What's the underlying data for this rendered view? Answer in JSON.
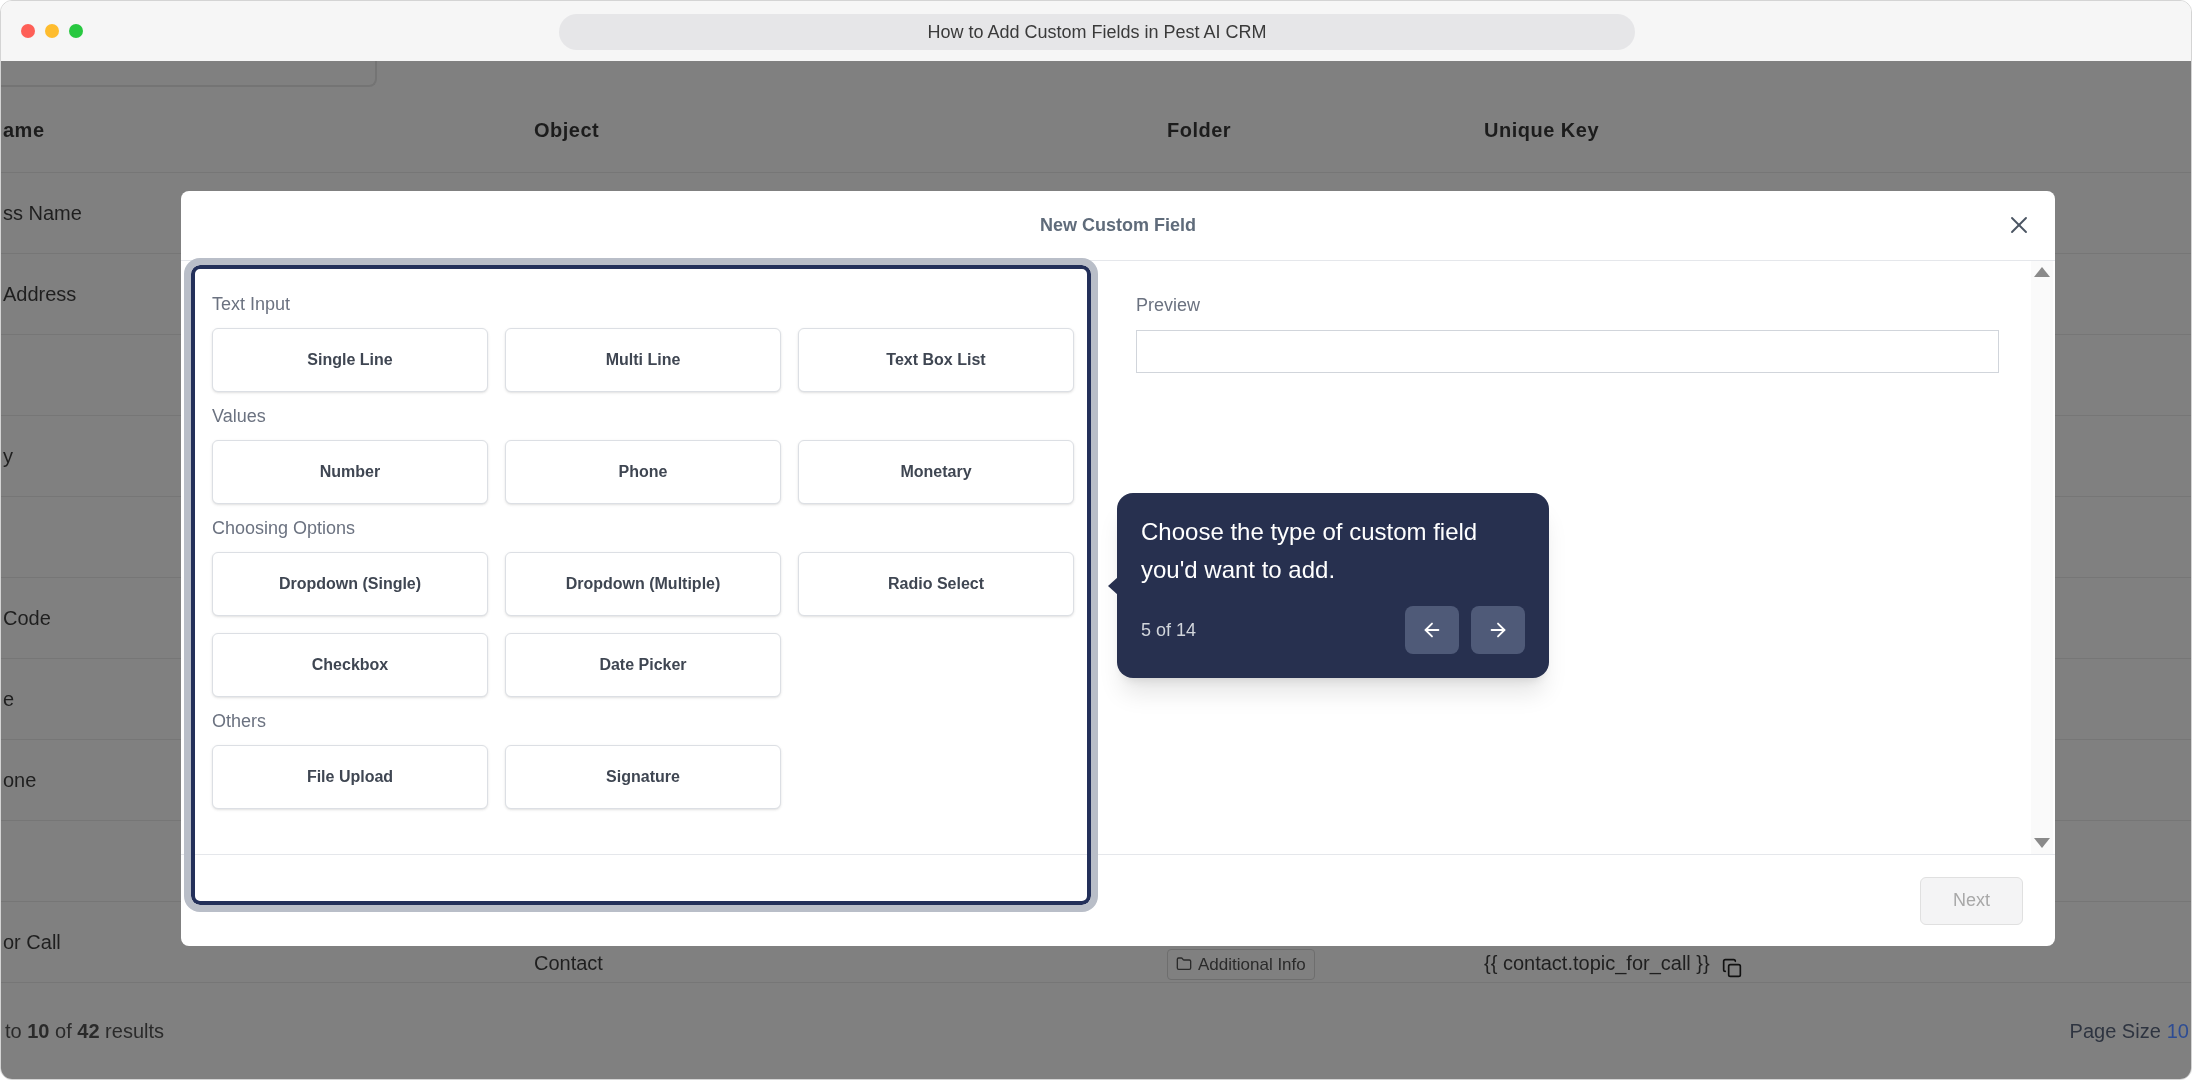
{
  "window": {
    "title": "How to Add Custom Fields in Pest AI CRM"
  },
  "table": {
    "columns": [
      "ame",
      "Object",
      "Folder",
      "Unique Key"
    ],
    "rows": [
      {
        "column_1": "ss Name"
      },
      {
        "column_1": "Address"
      },
      {},
      {
        "column_1": "y"
      },
      {},
      {
        "column_1": "Code"
      },
      {
        "column_1": "e"
      },
      {
        "column_1": "one"
      },
      {},
      {
        "column_1": "or Call",
        "object": "Contact",
        "folder": "Additional Info",
        "unique_key": "{{ contact.topic_for_call }}"
      }
    ],
    "results": "to **10** of **42** results",
    "page_size_label": "Page Size",
    "page_size": "10"
  },
  "modal": {
    "title": "New Custom Field",
    "sections": [
      {
        "label": "Text Input",
        "options": [
          "Single Line",
          "Multi Line",
          "Text Box List"
        ]
      },
      {
        "label": "Values",
        "options": [
          "Number",
          "Phone",
          "Monetary"
        ]
      },
      {
        "label": "Choosing Options",
        "options": [
          "Dropdown (Single)",
          "Dropdown (Multiple)",
          "Radio Select",
          "Checkbox",
          "Date Picker"
        ]
      },
      {
        "label": "Others",
        "options": [
          "File Upload",
          "Signature"
        ]
      }
    ],
    "preview": {
      "label": "Preview"
    },
    "next_button": {
      "label": "Next",
      "disabled": true
    }
  },
  "tour_tooltip": {
    "text": "Choose the type of custom field you'd want to add.",
    "step": "5 of 14"
  }
}
